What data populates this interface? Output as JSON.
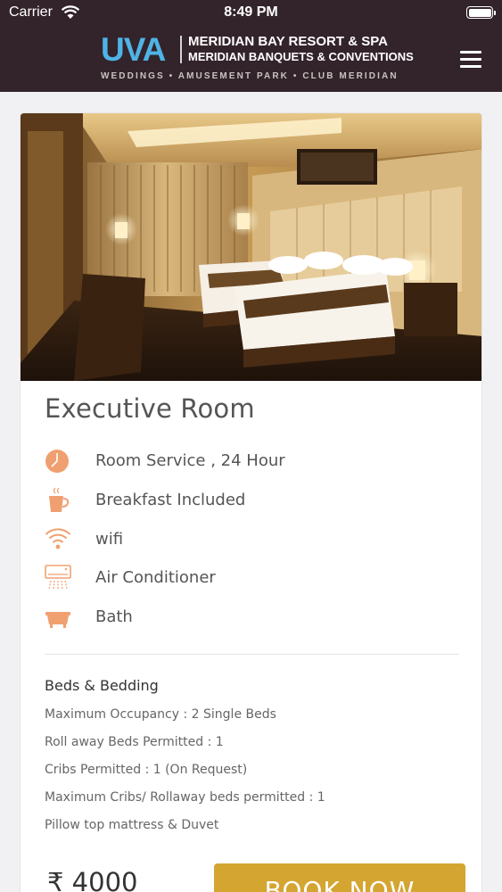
{
  "status_bar": {
    "carrier": "Carrier",
    "time": "8:49 PM"
  },
  "header": {
    "logo_mark": "UVA",
    "logo_line1": "MERIDIAN BAY RESORT & SPA",
    "logo_line2": "MERIDIAN BANQUETS & CONVENTIONS",
    "logo_tagline": "WEDDINGS • AMUSEMENT PARK • CLUB MERIDIAN",
    "menu_icon": "hamburger-menu-icon"
  },
  "room": {
    "title": "Executive Room",
    "photo": "hotel-room-photo",
    "amenities": [
      {
        "label": "Room Service , 24 Hour",
        "icon": "clock-icon"
      },
      {
        "label": "Breakfast Included",
        "icon": "coffee-cup-icon"
      },
      {
        "label": "wifi",
        "icon": "wifi-icon"
      },
      {
        "label": "Air Conditioner",
        "icon": "air-conditioner-icon"
      },
      {
        "label": "Bath",
        "icon": "bathtub-icon"
      }
    ],
    "beds_title": "Beds & Bedding",
    "beds_lines": [
      "Maximum Occupancy : 2 Single Beds",
      "Roll away Beds Permitted : 1",
      "Cribs Permitted : 1 (On Request)",
      "Maximum Cribs/ Rollaway beds permitted : 1",
      "Pillow top mattress & Duvet"
    ],
    "price": "₹ 4000",
    "book_label": "BOOK NOW"
  },
  "colors": {
    "header_bg": "#33232a",
    "accent_orange": "#f0a070",
    "book_button": "#d4a531",
    "logo_blue": "#4fb3e6"
  }
}
